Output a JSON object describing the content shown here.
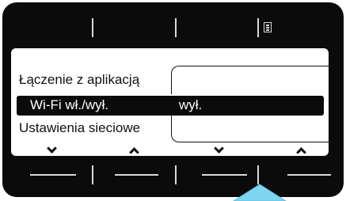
{
  "menu": {
    "items": [
      {
        "label": "Łączenie z aplikacją",
        "value": ""
      },
      {
        "label": "Wi-Fi wł./wył.",
        "value": "wył."
      },
      {
        "label": "Ustawienia sieciowe",
        "value": ""
      }
    ],
    "selected_index": 1
  },
  "top_softkeys": [
    {
      "icon": ""
    },
    {
      "icon": ""
    },
    {
      "icon": ""
    },
    {
      "icon": "document-icon"
    }
  ],
  "bottom_softkeys": [
    {
      "icon": "chevron-down-icon"
    },
    {
      "icon": "chevron-up-icon"
    },
    {
      "icon": "chevron-down-icon"
    },
    {
      "icon": "chevron-up-icon"
    }
  ],
  "colors": {
    "bezel": "#0b0b0b",
    "screen": "#ffffff",
    "divider": "#d9d9d9",
    "pointer": "#7fd4f0"
  }
}
